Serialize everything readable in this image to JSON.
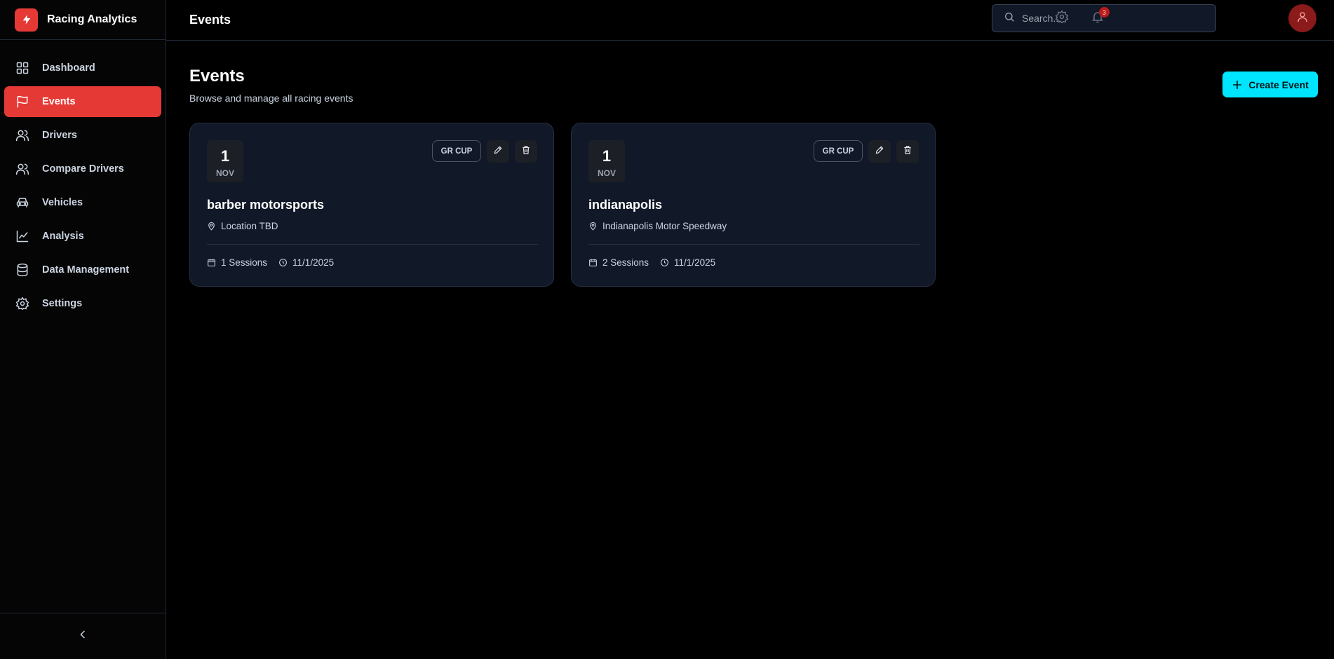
{
  "app": {
    "title": "Racing Analytics"
  },
  "sidebar": {
    "items": [
      {
        "label": "Dashboard",
        "icon": "grid-icon",
        "active": false
      },
      {
        "label": "Events",
        "icon": "flag-icon",
        "active": true
      },
      {
        "label": "Drivers",
        "icon": "users-icon",
        "active": false
      },
      {
        "label": "Compare Drivers",
        "icon": "users-icon",
        "active": false
      },
      {
        "label": "Vehicles",
        "icon": "car-icon",
        "active": false
      },
      {
        "label": "Analysis",
        "icon": "trending-up-icon",
        "active": false
      },
      {
        "label": "Data Management",
        "icon": "database-icon",
        "active": false
      },
      {
        "label": "Settings",
        "icon": "gear-icon",
        "active": false
      }
    ],
    "collapse_icon": "chevron-left-icon"
  },
  "topbar": {
    "title": "Events",
    "search_placeholder": "Search...",
    "notification_count": "3"
  },
  "page": {
    "title": "Events",
    "subtitle": "Browse and manage all racing events",
    "create_button": "Create Event"
  },
  "events": [
    {
      "day": "1",
      "month": "NOV",
      "tag": "GR CUP",
      "name": "barber motorsports",
      "location": "Location TBD",
      "sessions": "1 Sessions",
      "date": "11/1/2025"
    },
    {
      "day": "1",
      "month": "NOV",
      "tag": "GR CUP",
      "name": "indianapolis",
      "location": "Indianapolis Motor Speedway",
      "sessions": "2 Sessions",
      "date": "11/1/2025"
    }
  ],
  "colors": {
    "accent_red": "#e53935",
    "accent_cyan": "#00e5ff",
    "card_bg": "#111827",
    "page_bg": "#000000"
  }
}
